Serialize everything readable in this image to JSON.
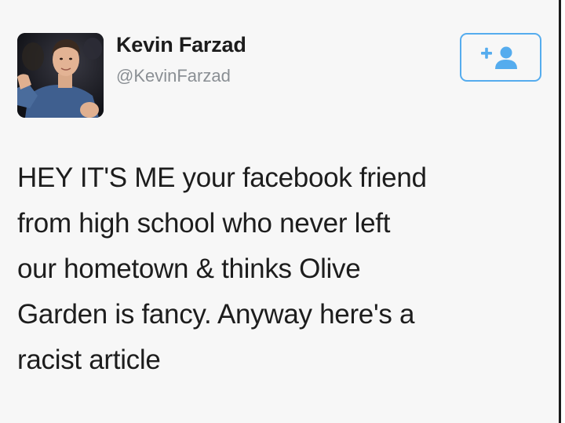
{
  "user": {
    "display_name": "Kevin Farzad",
    "handle": "@KevinFarzad",
    "avatar_icon": "profile-photo"
  },
  "follow_button": {
    "icon": "add-user-icon",
    "accent_color": "#55acee"
  },
  "tweet": {
    "lines": [
      "HEY IT'S ME your facebook friend",
      "from high school who never left",
      "our hometown & thinks Olive",
      "Garden is fancy. Anyway here's a",
      "racist article"
    ]
  },
  "colors": {
    "background": "#f7f7f7",
    "text": "#1d1d1d",
    "handle": "#8a8f94",
    "accent": "#55acee"
  }
}
